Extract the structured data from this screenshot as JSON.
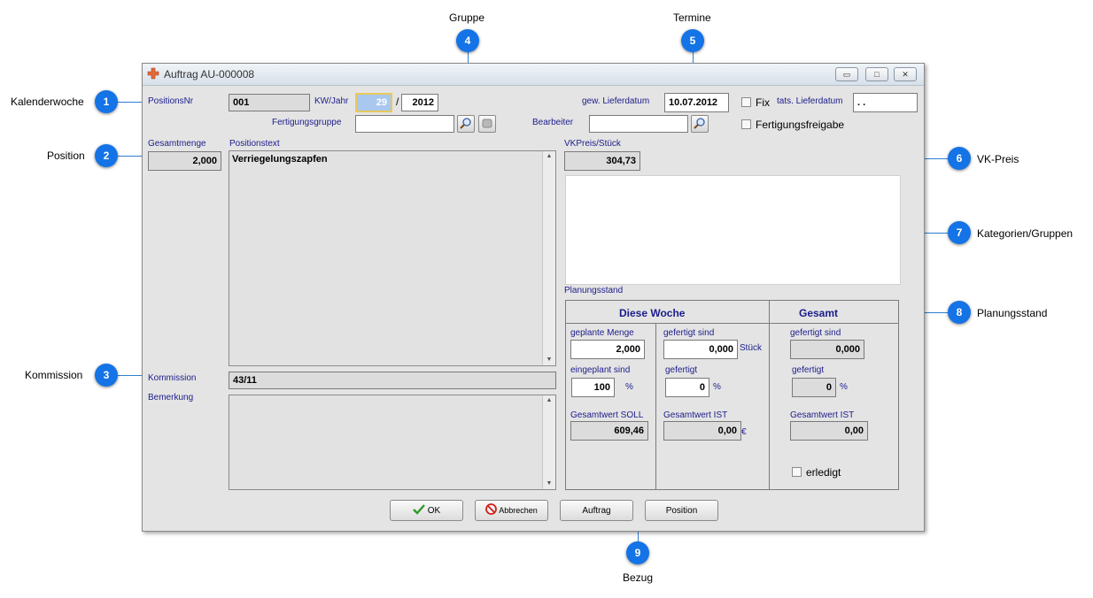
{
  "callouts": [
    {
      "num": "1",
      "text": "Kalenderwoche"
    },
    {
      "num": "2",
      "text": "Position"
    },
    {
      "num": "3",
      "text": "Kommission"
    },
    {
      "num": "4",
      "text": "Gruppe"
    },
    {
      "num": "5",
      "text": "Termine"
    },
    {
      "num": "6",
      "text": "VK-Preis"
    },
    {
      "num": "7",
      "text": "Kategorien/Gruppen"
    },
    {
      "num": "8",
      "text": "Planungsstand"
    },
    {
      "num": "9",
      "text": "Bezug"
    }
  ],
  "window": {
    "title": "Auftrag AU-000008",
    "minimize": "▭",
    "maximize": "□",
    "close": "✕"
  },
  "form": {
    "positionsnr_label": "PositionsNr",
    "positionsnr_value": "001",
    "kwjahr_label": "KW/Jahr",
    "kw_value": "29",
    "slash": "/",
    "jahr_value": "2012",
    "fertigungsgruppe_label": "Fertigungsgruppe",
    "fertigungsgruppe_value": "",
    "gew_lieferdatum_label": "gew. Lieferdatum",
    "gew_lieferdatum_value": "10.07.2012",
    "fix_label": "Fix",
    "tats_lieferdatum_label": "tats. Lieferdatum",
    "tats_lieferdatum_value": ". .",
    "bearbeiter_label": "Bearbeiter",
    "bearbeiter_value": "",
    "fertigungsfreigabe_label": "Fertigungsfreigabe",
    "gesamtmenge_label": "Gesamtmenge",
    "gesamtmenge_value": "2,000",
    "positionstext_label": "Positionstext",
    "positionstext_value": "Verriegelungszapfen",
    "vkpreis_label": "VKPreis/Stück",
    "vkpreis_value": "304,73",
    "kommission_label": "Kommission",
    "kommission_value": "43/11",
    "bemerkung_label": "Bemerkung",
    "bemerkung_value": "",
    "planungsstand_label": "Planungsstand"
  },
  "planung": {
    "diese_woche_head": "Diese Woche",
    "gesamt_head": "Gesamt",
    "geplante_menge_label": "geplante Menge",
    "geplante_menge_value": "2,000",
    "gefertigt_sind_label": "gefertigt sind",
    "gefertigt_sind_value": "0,000",
    "stueck": "Stück",
    "eingeplant_sind_label": "eingeplant sind",
    "eingeplant_sind_value": "100",
    "pct1": "%",
    "gefertigt_label": "gefertigt",
    "gefertigt_value": "0",
    "pct2": "%",
    "gesamtwert_soll_label": "Gesamtwert SOLL",
    "gesamtwert_soll_value": "609,46",
    "gesamtwert_ist_label": "Gesamtwert IST",
    "gesamtwert_ist_value": "0,00",
    "euro": "€",
    "g_gefertigt_sind_label": "gefertigt sind",
    "g_gefertigt_sind_value": "0,000",
    "g_gefertigt_label": "gefertigt",
    "g_gefertigt_value": "0",
    "pct3": "%",
    "g_gesamtwert_ist_label": "Gesamtwert IST",
    "g_gesamtwert_ist_value": "0,00",
    "erledigt_label": "erledigt"
  },
  "buttons": {
    "ok": "OK",
    "abbrechen": "Abbrechen",
    "auftrag": "Auftrag",
    "position": "Position"
  },
  "colors": {
    "badge": "#1473e6",
    "label": "#1c1c8c",
    "line": "#2f7fd1"
  }
}
